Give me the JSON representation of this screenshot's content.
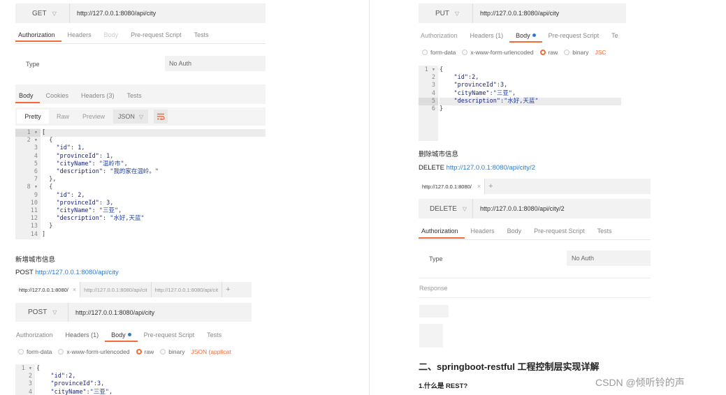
{
  "get_request": {
    "method": "GET",
    "url": "http://127.0.0.1:8080/api/city",
    "tabs": [
      "Authorization",
      "Headers",
      "Body",
      "Pre-request Script",
      "Tests"
    ],
    "auth_type_label": "Type",
    "auth_type_value": "No Auth",
    "response_tabs": [
      "Body",
      "Cookies",
      "Headers (3)",
      "Tests"
    ],
    "view_modes": [
      "Pretty",
      "Raw",
      "Preview"
    ],
    "format": "JSON",
    "line_numbers": [
      "1",
      "2",
      "3",
      "4",
      "5",
      "6",
      "7",
      "8",
      "9",
      "10",
      "11",
      "12",
      "13",
      "14"
    ],
    "response_lines": [
      "[",
      "  {",
      "    \"id\": 1,",
      "    \"provinceId\": 1,",
      "    \"cityName\": \"温岭市\",",
      "    \"description\": \"我的家在温岭。\"",
      "  },",
      "  {",
      "    \"id\": 2,",
      "    \"provinceId\": 3,",
      "    \"cityName\": \"三亚\",",
      "    \"description\": \"水好,天蓝\"",
      "  }",
      "]"
    ]
  },
  "add_section": {
    "heading": "新增城市信息",
    "post_prefix": "POST ",
    "post_url": "http://127.0.0.1:8080/api/city",
    "url_tabs": [
      "http://127.0.0.1:8080/",
      "http://127.0.0.1:8080/api/cit",
      "http://127.0.0.1:8080/api/cit"
    ],
    "method": "POST",
    "url": "http://127.0.0.1:8080/api/city",
    "tabs": [
      "Authorization",
      "Headers (1)",
      "Body",
      "Pre-request Script",
      "Tests"
    ],
    "body_modes": [
      "form-data",
      "x-www-form-urlencoded",
      "raw",
      "binary"
    ],
    "content_type": "JSON (applicat",
    "line_numbers": [
      "1",
      "2",
      "3",
      "4"
    ],
    "body_lines": [
      "{",
      "    \"id\":2,",
      "    \"provinceId\":3,",
      "    \"cityName\":\"三亚\","
    ]
  },
  "put_request": {
    "method": "PUT",
    "url": "http://127.0.0.1:8080/api/city",
    "tabs": [
      "Authorization",
      "Headers (1)",
      "Body",
      "Pre-request Script",
      "Te"
    ],
    "body_modes": [
      "form-data",
      "x-www-form-urlencoded",
      "raw",
      "binary"
    ],
    "content_type": "JSC",
    "line_numbers": [
      "1",
      "2",
      "3",
      "4",
      "5",
      "6"
    ],
    "body_lines": [
      "{",
      "    \"id\":2,",
      "    \"provinceId\":3,",
      "    \"cityName\":\"三亚\",",
      "    \"description\":\"水好,天蓝\"",
      "}"
    ]
  },
  "delete_section": {
    "heading": "删除城市信息",
    "delete_prefix": "DELETE ",
    "delete_url": "http://127.0.0.1:8080/api/city/2",
    "url_tab": "http://127.0.0.1:8080/",
    "method": "DELETE",
    "url": "http://127.0.0.1:8080/api/city/2",
    "tabs": [
      "Authorization",
      "Headers",
      "Body",
      "Pre-request Script",
      "Tests"
    ],
    "auth_type_label": "Type",
    "auth_type_value": "No Auth",
    "response_label": "Response"
  },
  "article": {
    "heading2": "二、springboot-restful 工程控制层实现详解",
    "heading3": "1.什么是 REST?"
  },
  "watermark": "CSDN @倾听铃的声",
  "colors": {
    "accent": "#f26b3a",
    "link": "#2d7bd6",
    "bar": "#f2f2f2"
  }
}
